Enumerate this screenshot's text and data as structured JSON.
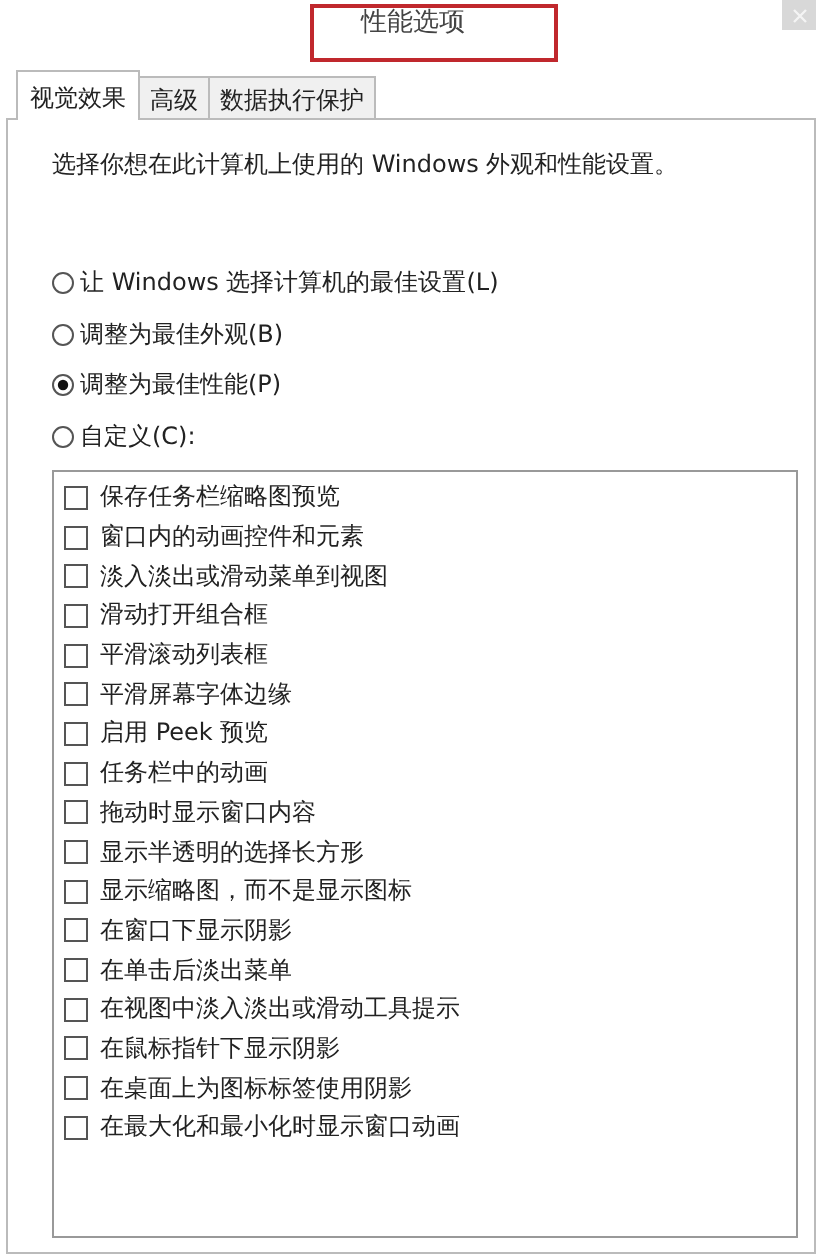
{
  "window": {
    "title": "性能选项"
  },
  "tabs": [
    {
      "label": "视觉效果",
      "selected": true
    },
    {
      "label": "高级",
      "selected": false
    },
    {
      "label": "数据执行保护",
      "selected": false
    }
  ],
  "description": "选择你想在此计算机上使用的 Windows 外观和性能设置。",
  "options": [
    {
      "label": "让 Windows 选择计算机的最佳设置(L)",
      "selected": false
    },
    {
      "label": "调整为最佳外观(B)",
      "selected": false
    },
    {
      "label": "调整为最佳性能(P)",
      "selected": true
    },
    {
      "label": "自定义(C):",
      "selected": false
    }
  ],
  "effects": [
    {
      "label": "保存任务栏缩略图预览",
      "checked": false
    },
    {
      "label": "窗口内的动画控件和元素",
      "checked": false
    },
    {
      "label": "淡入淡出或滑动菜单到视图",
      "checked": false
    },
    {
      "label": "滑动打开组合框",
      "checked": false
    },
    {
      "label": "平滑滚动列表框",
      "checked": false
    },
    {
      "label": "平滑屏幕字体边缘",
      "checked": false
    },
    {
      "label": "启用 Peek 预览",
      "checked": false
    },
    {
      "label": "任务栏中的动画",
      "checked": false
    },
    {
      "label": "拖动时显示窗口内容",
      "checked": false
    },
    {
      "label": "显示半透明的选择长方形",
      "checked": false
    },
    {
      "label": "显示缩略图，而不是显示图标",
      "checked": false
    },
    {
      "label": "在窗口下显示阴影",
      "checked": false
    },
    {
      "label": "在单击后淡出菜单",
      "checked": false
    },
    {
      "label": "在视图中淡入淡出或滑动工具提示",
      "checked": false
    },
    {
      "label": "在鼠标指针下显示阴影",
      "checked": false
    },
    {
      "label": "在桌面上为图标标签使用阴影",
      "checked": false
    },
    {
      "label": "在最大化和最小化时显示窗口动画",
      "checked": false
    }
  ]
}
